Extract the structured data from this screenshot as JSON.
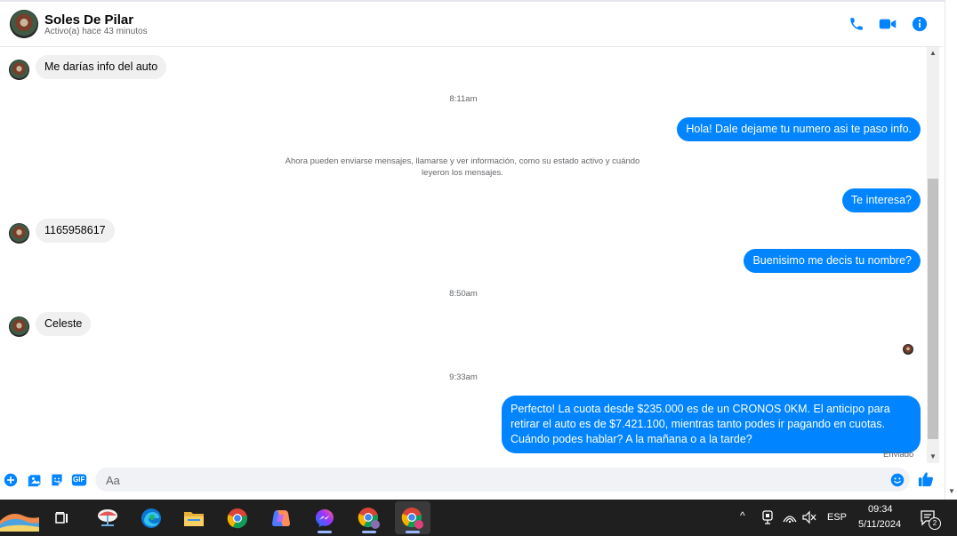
{
  "header": {
    "contact_name": "Soles De Pilar",
    "status": "Activo(a) hace 43 minutos",
    "icons": {
      "call": "phone-icon",
      "video": "video-camera-icon",
      "info": "info-icon"
    },
    "accent_color": "#0084ff"
  },
  "messages": {
    "in_1": "Me darías info del auto",
    "time_1": "8:11am",
    "out_1": "Hola! Dale dejame tu numero  asi te paso info.",
    "system_notice": "Ahora pueden enviarse mensajes, llamarse y ver información, como su estado activo y cuándo leyeron los mensajes.",
    "out_2": "Te interesa?",
    "in_2": "1165958617",
    "out_3": "Buenisimo me decis tu nombre?",
    "time_2": "8:50am",
    "in_3": "Celeste",
    "time_3": "9:33am",
    "out_4": "Perfecto! La cuota desde $235.000 es de un CRONOS 0KM. El anticipo para retirar el auto es de $7.421.100, mientras tanto podes ir pagando en cuotas. Cuándo podes hablar? A la mañana o a la tarde?",
    "sent_status": "Enviado"
  },
  "composer": {
    "placeholder": "Aa",
    "gif_label": "GIF",
    "icons": {
      "add": "plus-circle-icon",
      "image": "image-icon",
      "sticker": "sticker-icon",
      "gif": "gif-icon",
      "emoji": "emoji-icon",
      "like": "thumbs-up-icon"
    }
  },
  "taskbar": {
    "apps": [
      "widgets-icon",
      "task-view-icon",
      "app-icon",
      "edge-icon",
      "file-explorer-icon",
      "chrome-icon",
      "copilot-icon",
      "messenger-icon",
      "chrome-profile-icon",
      "chrome-profile-c-icon"
    ],
    "language": "ESP",
    "time": "09:34",
    "date": "5/11/2024",
    "notification_count": "2"
  }
}
